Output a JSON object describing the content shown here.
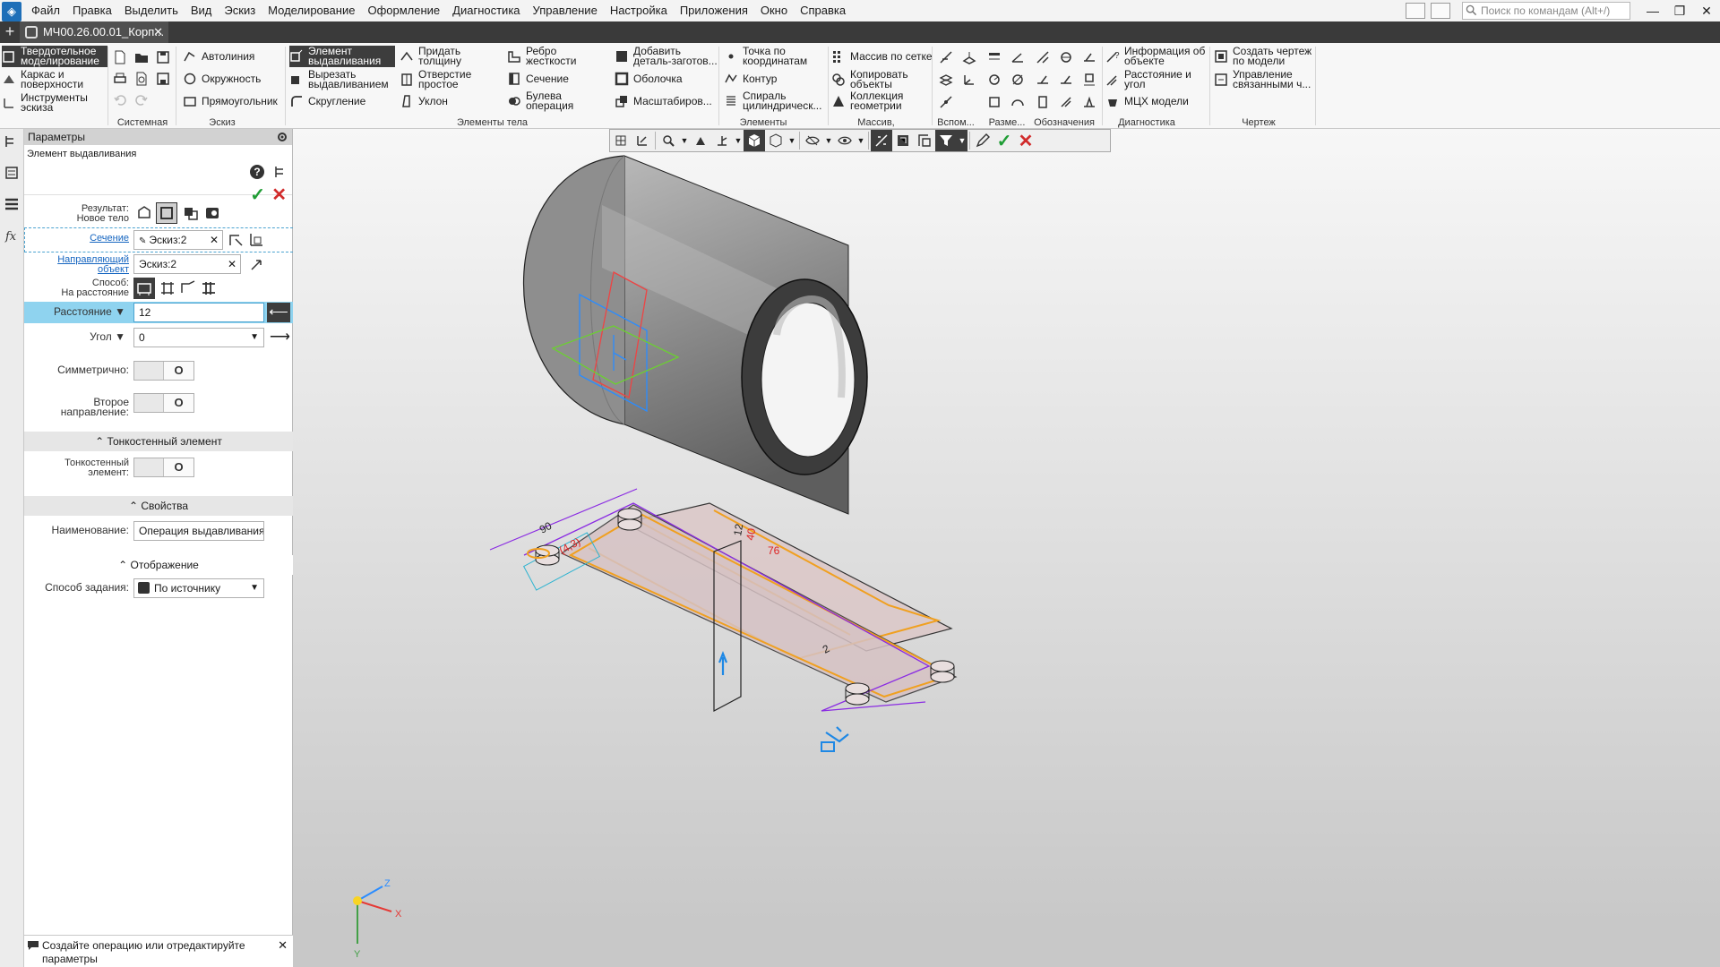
{
  "menu": [
    "Файл",
    "Правка",
    "Выделить",
    "Вид",
    "Эскиз",
    "Моделирование",
    "Оформление",
    "Диагностика",
    "Управление",
    "Настройка",
    "Приложения",
    "Окно",
    "Справка"
  ],
  "search_placeholder": "Поиск по командам (Alt+/)",
  "window_controls": [
    "—",
    "❐",
    "✕"
  ],
  "document_tab": "МЧ00.26.00.01_Корп...",
  "ribbon": {
    "modes": [
      {
        "label": "Твердотельное моделирование",
        "icon": "solid-body-icon",
        "active": true
      },
      {
        "label": "Каркас и поверхности",
        "icon": "surface-icon"
      },
      {
        "label": "Инструменты эскиза",
        "icon": "sketch-tools-icon"
      }
    ],
    "sketch": [
      "Автолиния",
      "Окружность",
      "Прямоугольник"
    ],
    "body1": [
      "Элемент выдавливания",
      "Вырезать выдавливанием",
      "Скругление"
    ],
    "body2": [
      "Придать толщину",
      "Отверстие простое",
      "Уклон"
    ],
    "body3": [
      "Ребро жесткости",
      "Сечение",
      "Булева операция"
    ],
    "body4": [
      "Добавить деталь-заготов...",
      "Оболочка",
      "Масштабиров..."
    ],
    "frame": [
      "Точка по координатам",
      "Контур",
      "Спираль цилиндрическ..."
    ],
    "array": [
      "Массив по сетке",
      "Копировать объекты",
      "Коллекция геометрии"
    ],
    "diag": [
      "Информация об объекте",
      "Расстояние и угол",
      "МЦХ модели"
    ],
    "drawing": [
      "Создать чертеж по модели",
      "Управление связанными ч..."
    ],
    "groups": [
      "Системная",
      "Эскиз",
      "Элементы тела",
      "Элементы каркаса",
      "Массив, копирование",
      "Вспом...",
      "Разме...",
      "Обозначения",
      "Диагностика",
      "Чертеж"
    ]
  },
  "panel": {
    "title": "Параметры",
    "operation": "Элемент выдавливания",
    "result_label": "Результат:",
    "result_value": "Новое тело",
    "section_label": "Сечение",
    "section_value": "Эскиз:2",
    "direction_label1": "Направляющий",
    "direction_label2": "объект",
    "direction_value": "Эскиз:2",
    "method_label": "Способ:",
    "method_value": "На расстояние",
    "distance_label": "Расстояние",
    "distance_value": "12",
    "angle_label": "Угол",
    "angle_value": "0",
    "symmetric_label": "Симметрично:",
    "second_dir_label": "Второе направление:",
    "thin_section": "Тонкостенный элемент",
    "thin_label1": "Тонкостенный",
    "thin_label2": "элемент:",
    "props_section": "Свойства",
    "name_label": "Наименование:",
    "name_value": "Операция выдавливания:",
    "display_section": "Отображение",
    "display_method_label": "Способ задания:",
    "display_method_value": "По источнику",
    "toggle_state": "O",
    "status_text": "Создайте операцию или отредактируйте параметры"
  },
  "viewport": {
    "dims": [
      "90",
      "(4,3)",
      "2",
      "12",
      "40",
      "76"
    ],
    "axes": [
      "Z",
      "X",
      "Y"
    ]
  }
}
